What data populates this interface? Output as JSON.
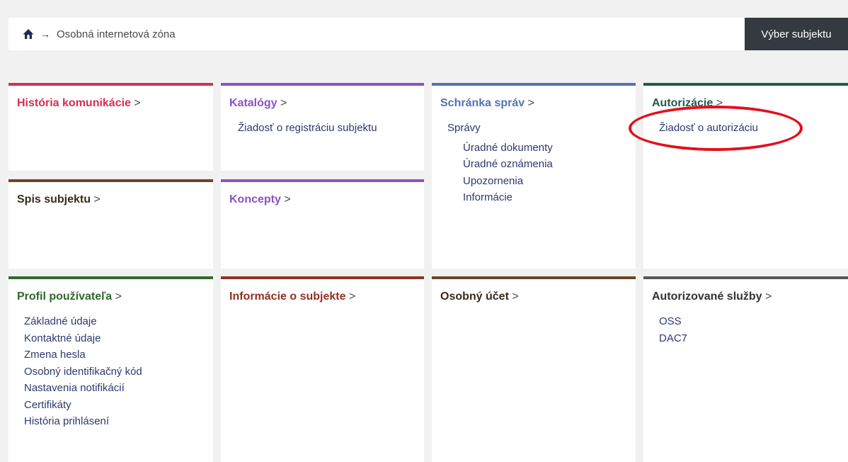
{
  "breadcrumb": {
    "home_icon": "home-icon",
    "separator": "→",
    "current": "Osobná internetová zóna"
  },
  "header": {
    "select_subject_label": "Výber subjektu"
  },
  "colors": {
    "historia": "#d6304f",
    "katalogy": "#8c52c4",
    "schranka": "#5573b4",
    "autorizacie": "#1f5c4c",
    "spis": "#6b4727",
    "koncepty": "#8c52c4",
    "profil": "#2e6a2b",
    "informacie": "#8e3222",
    "ucet": "#6b4727",
    "sluzby": "#555555",
    "annotation": "#e3101c"
  },
  "tiles": {
    "historia": {
      "title": "História komunikácie",
      "chevron": ">"
    },
    "katalogy": {
      "title": "Katalógy",
      "chevron": ">",
      "links": [
        "Žiadosť o registráciu subjektu"
      ]
    },
    "schranka": {
      "title": "Schránka správ",
      "chevron": ">",
      "links": [
        "Správy"
      ],
      "sublinks": [
        "Úradné dokumenty",
        "Úradné oznámenia",
        "Upozornenia",
        "Informácie"
      ]
    },
    "autorizacie": {
      "title": "Autorizácie",
      "chevron": ">",
      "links": [
        "Žiadosť o autorizáciu"
      ]
    },
    "spis": {
      "title": "Spis subjektu",
      "chevron": ">"
    },
    "koncepty": {
      "title": "Koncepty",
      "chevron": ">"
    },
    "profil": {
      "title": "Profil používateľa",
      "chevron": ">",
      "links": [
        "Základné údaje",
        "Kontaktné údaje",
        "Zmena hesla",
        "Osobný identifikačný kód",
        "Nastavenia notifikácií",
        "Certifikáty",
        "História prihlásení"
      ]
    },
    "informacie": {
      "title": "Informácie o subjekte",
      "chevron": ">"
    },
    "ucet": {
      "title": "Osobný účet",
      "chevron": ">"
    },
    "sluzby": {
      "title": "Autorizované služby",
      "chevron": ">",
      "links": [
        "OSS",
        "DAC7"
      ]
    }
  }
}
